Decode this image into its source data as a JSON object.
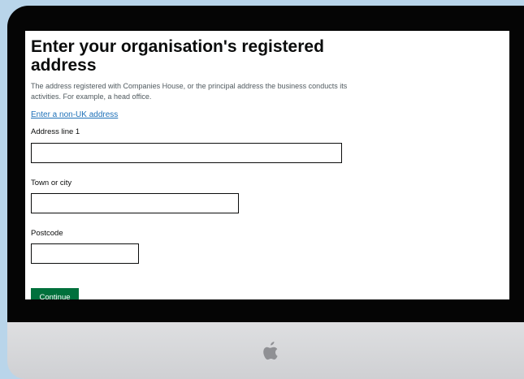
{
  "page": {
    "title": "Enter your organisation's registered address",
    "hint": "The address registered with Companies House, or the principal address the business conducts its activities. For example, a head office.",
    "non_uk_link": "Enter a non-UK address"
  },
  "form": {
    "address_line_1": {
      "label": "Address line 1",
      "value": ""
    },
    "town_or_city": {
      "label": "Town or city",
      "value": ""
    },
    "postcode": {
      "label": "Postcode",
      "value": ""
    }
  },
  "actions": {
    "continue_label": "Continue"
  },
  "colors": {
    "background": "#b9d5ea",
    "monitor_frame": "#050505",
    "link": "#1d70b8",
    "button": "#00703c"
  },
  "icons": {
    "chin_logo": "apple-icon"
  }
}
